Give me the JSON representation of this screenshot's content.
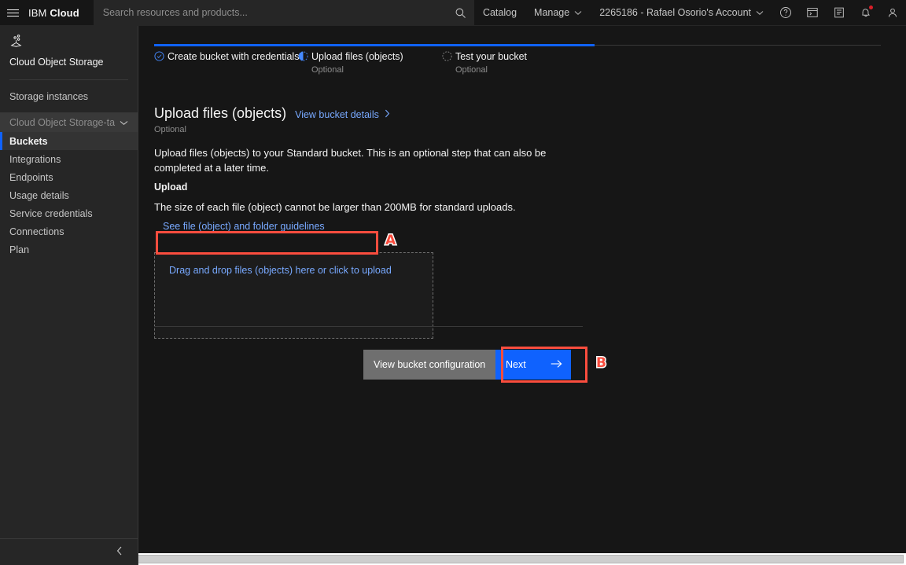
{
  "header": {
    "menu_icon": "hamburger-icon",
    "brand_ibm": "IBM",
    "brand_cloud": "Cloud",
    "search": {
      "placeholder": "Search resources and products...",
      "value": "",
      "icon": "search-icon"
    },
    "catalog_label": "Catalog",
    "manage_label": "Manage",
    "account_label": "2265186 - Rafael Osorio's Account",
    "icons": {
      "help": "help-circle-icon",
      "shell": "cloud-shell-icon",
      "docs": "docs-icon",
      "notifications": "bell-icon",
      "profile": "user-avatar-icon"
    },
    "notification_badge": true
  },
  "sidebar": {
    "service_icon": "object-storage-icon",
    "service_title": "Cloud Object Storage",
    "storage_instances_label": "Storage instances",
    "instance_group": {
      "label": "Cloud Object Storage-ta",
      "chevron": "chevron-down-icon"
    },
    "items": [
      {
        "label": "Buckets",
        "active": true
      },
      {
        "label": "Integrations",
        "active": false
      },
      {
        "label": "Endpoints",
        "active": false
      },
      {
        "label": "Usage details",
        "active": false
      },
      {
        "label": "Service credentials",
        "active": false
      },
      {
        "label": "Connections",
        "active": false
      },
      {
        "label": "Plan",
        "active": false
      }
    ],
    "collapse_icon": "chevron-left-icon"
  },
  "progress": {
    "steps": [
      {
        "label": "Create bucket with credentials",
        "sub": "",
        "state": "complete",
        "icon": "check-circle-icon"
      },
      {
        "label": "Upload files (objects)",
        "sub": "Optional",
        "state": "current",
        "icon": "half-circle-icon"
      },
      {
        "label": "Test your bucket",
        "sub": "Optional",
        "state": "incomplete",
        "icon": "dotted-circle-icon"
      }
    ]
  },
  "page": {
    "title": "Upload files (objects)",
    "details_link": "View bucket details",
    "details_chevron": "chevron-right-icon",
    "optional": "Optional",
    "description": "Upload files (objects) to your Standard bucket. This is an optional step that can also be completed at a later time."
  },
  "upload": {
    "section_label": "Upload",
    "size_note": "The size of each file (object) cannot be larger than 200MB for standard uploads.",
    "guidelines_link": "See file (object) and folder guidelines",
    "dropzone_label": "Drag and drop files (objects) here or click to upload"
  },
  "actions": {
    "secondary_label": "View bucket configuration",
    "primary_label": "Next",
    "primary_icon": "arrow-right-icon"
  },
  "annotations": [
    {
      "id": "A",
      "target": "dropzone-label"
    },
    {
      "id": "B",
      "target": "next-button"
    }
  ],
  "chat": {
    "icon": "chat-bubble-icon"
  },
  "colors": {
    "accent_blue": "#0f62fe",
    "link_blue": "#78a9ff",
    "highlight_red": "#fa4d3e",
    "bg": "#161616",
    "sidebar_bg": "#262626"
  }
}
